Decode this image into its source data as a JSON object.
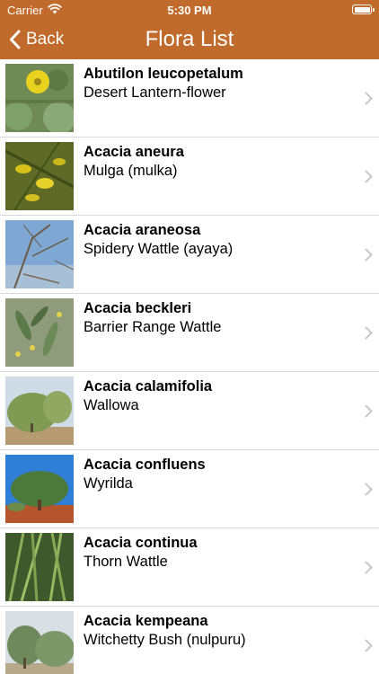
{
  "status_bar": {
    "carrier": "Carrier",
    "time": "5:30 PM",
    "battery_level": 1.0
  },
  "nav": {
    "back_label": "Back",
    "title": "Flora List"
  },
  "colors": {
    "accent": "#c06a2b",
    "separator": "#d9d9d9",
    "chevron": "#c7c7cc"
  },
  "plants": [
    {
      "scientific": "Abutilon leucopetalum",
      "common": "Desert Lantern-flower",
      "thumb": "yellow-flower-photo"
    },
    {
      "scientific": "Acacia aneura",
      "common": "Mulga (mulka)",
      "thumb": "yellow-blossom-photo"
    },
    {
      "scientific": "Acacia araneosa",
      "common": "Spidery Wattle (ayaya)",
      "thumb": "sky-branches-photo"
    },
    {
      "scientific": "Acacia beckleri",
      "common": "Barrier Range Wattle",
      "thumb": "wattle-leaves-photo"
    },
    {
      "scientific": "Acacia calamifolia",
      "common": "Wallowa",
      "thumb": "shrub-photo"
    },
    {
      "scientific": "Acacia confluens",
      "common": "Wyrilda",
      "thumb": "tree-red-soil-photo"
    },
    {
      "scientific": "Acacia continua",
      "common": "Thorn Wattle",
      "thumb": "green-stems-photo"
    },
    {
      "scientific": "Acacia kempeana",
      "common": "Witchetty Bush (nulpuru)",
      "thumb": "bush-photo"
    }
  ]
}
